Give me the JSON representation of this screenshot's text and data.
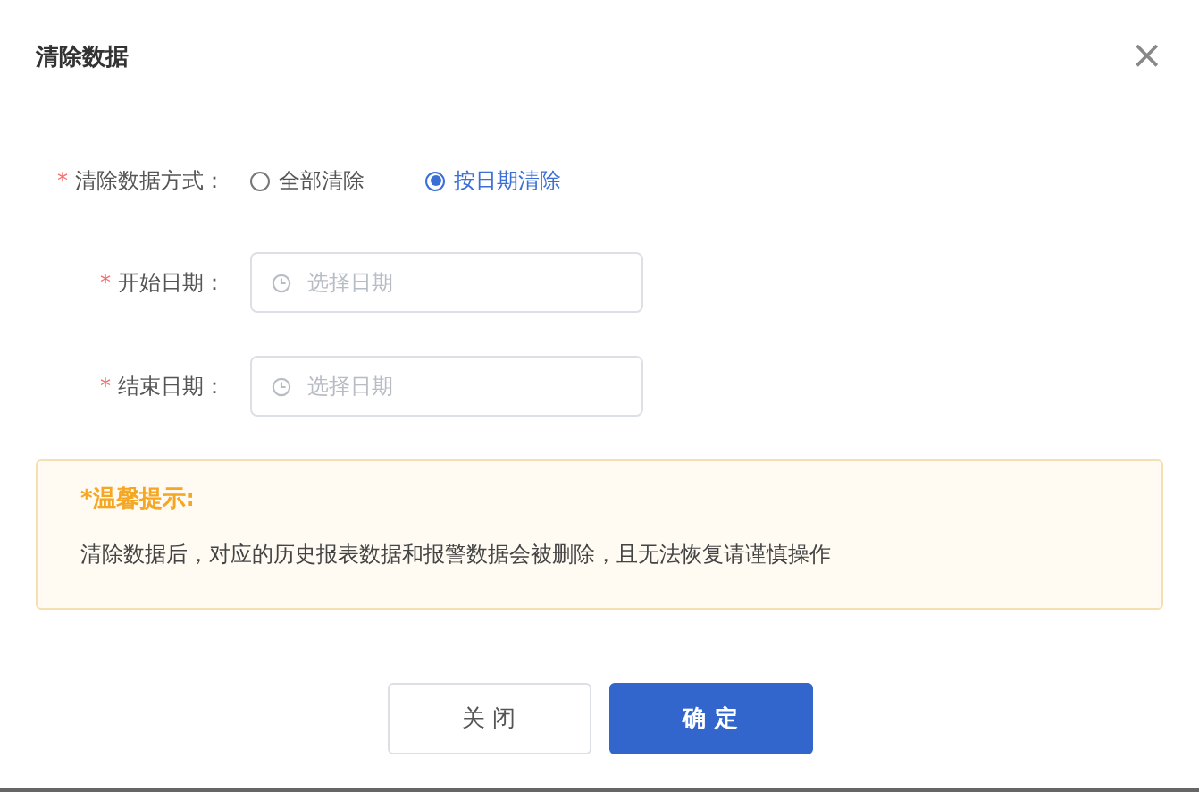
{
  "dialog": {
    "title": "清除数据",
    "close_icon": "×"
  },
  "form": {
    "mode": {
      "required_mark": "*",
      "label": "清除数据方式：",
      "options": [
        {
          "label": "全部清除",
          "selected": false
        },
        {
          "label": "按日期清除",
          "selected": true
        }
      ]
    },
    "date_fields": [
      {
        "required_mark": "*",
        "label": "开始日期：",
        "placeholder": "选择日期"
      },
      {
        "required_mark": "*",
        "label": "结束日期：",
        "placeholder": "选择日期"
      }
    ]
  },
  "notice": {
    "title": "*温馨提示:",
    "text": "清除数据后，对应的历史报表数据和报警数据会被删除，且无法恢复请谨慎操作"
  },
  "buttons": [
    {
      "label": "关 闭",
      "kind": "secondary"
    },
    {
      "label": "确 定",
      "kind": "primary"
    }
  ]
}
